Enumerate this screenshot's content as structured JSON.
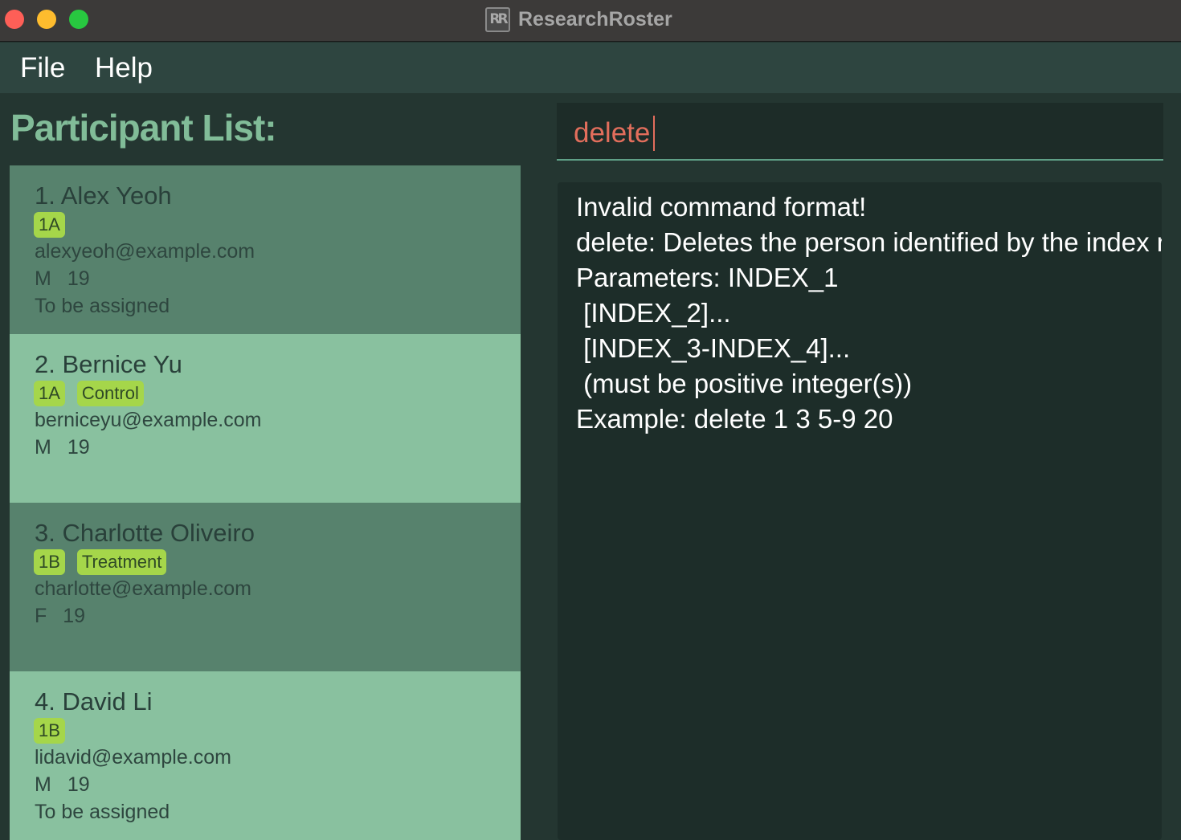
{
  "window": {
    "title": "ResearchRoster",
    "logo_text": "RR"
  },
  "menu": {
    "file": "File",
    "help": "Help"
  },
  "participant_list": {
    "title": "Participant List:",
    "participants": [
      {
        "name": "1. Alex Yeoh",
        "tags": [
          "1A"
        ],
        "email": "alexyeoh@example.com",
        "gender": "M",
        "age": "19",
        "status": "To be assigned"
      },
      {
        "name": "2. Bernice Yu",
        "tags": [
          "1A",
          "Control"
        ],
        "email": "berniceyu@example.com",
        "gender": "M",
        "age": "19",
        "status": ""
      },
      {
        "name": "3. Charlotte Oliveiro",
        "tags": [
          "1B",
          "Treatment"
        ],
        "email": "charlotte@example.com",
        "gender": "F",
        "age": "19",
        "status": ""
      },
      {
        "name": "4. David Li",
        "tags": [
          "1B"
        ],
        "email": "lidavid@example.com",
        "gender": "M",
        "age": "19",
        "status": "To be assigned"
      }
    ]
  },
  "command_box": {
    "value": "delete"
  },
  "result_display": {
    "lines": [
      "Invalid command format!",
      "delete: Deletes the person identified by the index n",
      "Parameters: INDEX_1",
      " [INDEX_2]...",
      " [INDEX_3-INDEX_4]...",
      " (must be positive integer(s))",
      "Example: delete 1 3 5-9 20"
    ]
  }
}
